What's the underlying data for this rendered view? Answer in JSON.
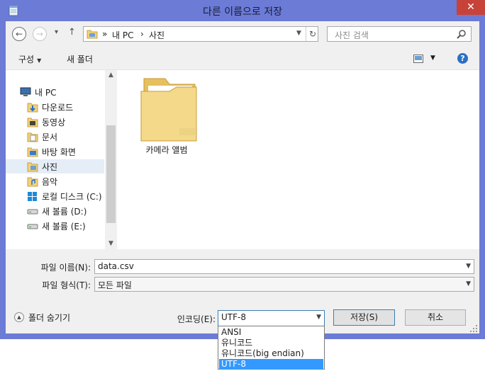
{
  "window": {
    "title": "다른 이름으로 저장",
    "close_glyph": "✕"
  },
  "nav": {
    "back_glyph": "←",
    "forward_glyph": "→",
    "history_glyph": "▾",
    "up_glyph": "↑",
    "breadcrumb": [
      "»",
      "내 PC",
      "›",
      "사진"
    ],
    "refresh_glyph": "↻",
    "search_placeholder": "사진 검색"
  },
  "toolbar": {
    "organize": "구성",
    "new_folder": "새 폴더",
    "help_glyph": "?"
  },
  "tree": [
    {
      "label": "내 PC",
      "icon": "computer-icon"
    },
    {
      "label": "다운로드",
      "icon": "downloads-folder-icon"
    },
    {
      "label": "동영상",
      "icon": "videos-folder-icon"
    },
    {
      "label": "문서",
      "icon": "documents-folder-icon"
    },
    {
      "label": "바탕 화면",
      "icon": "desktop-folder-icon"
    },
    {
      "label": "사진",
      "icon": "pictures-folder-icon",
      "selected": true
    },
    {
      "label": "음악",
      "icon": "music-folder-icon"
    },
    {
      "label": "로컬 디스크 (C:)",
      "icon": "local-disk-icon"
    },
    {
      "label": "새 볼륨 (D:)",
      "icon": "drive-icon"
    },
    {
      "label": "새 볼륨 (E:)",
      "icon": "drive-icon"
    }
  ],
  "files": [
    {
      "label": "카메라 앨범",
      "icon": "folder-icon"
    }
  ],
  "form": {
    "filename_label": "파일 이름(N):",
    "filename_value": "data.csv",
    "filetype_label": "파일 형식(T):",
    "filetype_value": "모든 파일",
    "encoding_label": "인코딩(E):",
    "encoding_value": "UTF-8",
    "encoding_options": [
      "ANSI",
      "유니코드",
      "유니코드(big endian)",
      "UTF-8"
    ],
    "encoding_selected_index": 3,
    "save_button": "저장(S)",
    "cancel_button": "취소",
    "hide_folders": "폴더 숨기기"
  },
  "colors": {
    "window_frame": "#6b7bd6",
    "close_button": "#c7433a",
    "selection": "#3399ff",
    "folder_yellow": "#f3d27a"
  }
}
